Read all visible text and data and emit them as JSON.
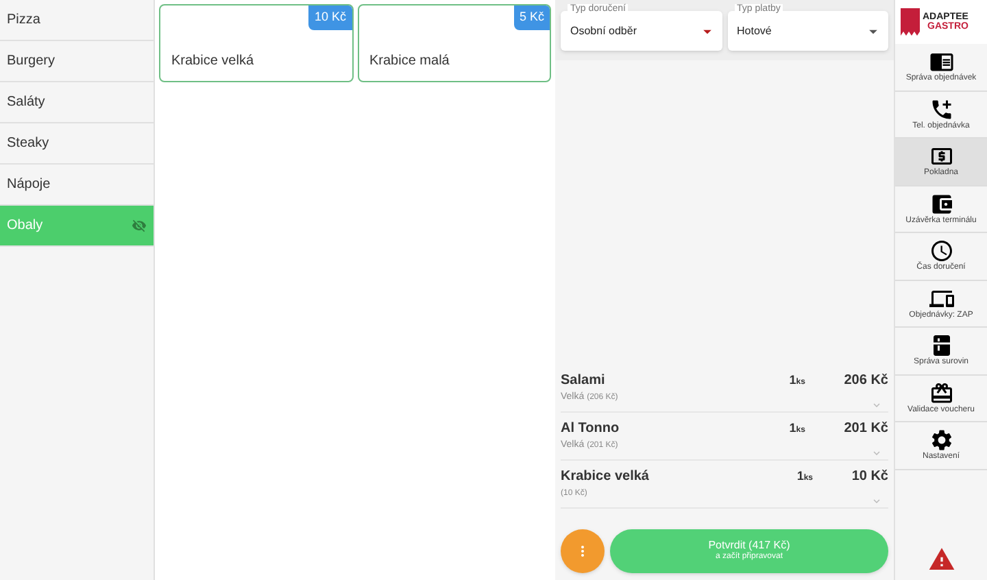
{
  "categories": [
    {
      "label": "Pizza",
      "selected": false,
      "hidden": false
    },
    {
      "label": "Burgery",
      "selected": false,
      "hidden": false
    },
    {
      "label": "Saláty",
      "selected": false,
      "hidden": false
    },
    {
      "label": "Steaky",
      "selected": false,
      "hidden": false
    },
    {
      "label": "Nápoje",
      "selected": false,
      "hidden": false
    },
    {
      "label": "Obaly",
      "selected": true,
      "hidden": true
    }
  ],
  "products": [
    {
      "name": "Krabice velká",
      "price": "10 Kč"
    },
    {
      "name": "Krabice malá",
      "price": "5 Kč"
    }
  ],
  "order": {
    "fields": [
      {
        "label": "Typ doručení",
        "value": "Osobní odběr",
        "color": "#b71c1c"
      },
      {
        "label": "Typ platby",
        "value": "Hotové",
        "color": "#555555"
      }
    ],
    "items": [
      {
        "name": "Salami",
        "detail": "Velká",
        "detail_price": "(206 Kč)",
        "quantity": "1",
        "unit": "ks",
        "price": "206 Kč"
      },
      {
        "name": "Al Tonno",
        "detail": "Velká",
        "detail_price": "(201 Kč)",
        "quantity": "1",
        "unit": "ks",
        "price": "201 Kč"
      },
      {
        "name": "Krabice velká",
        "detail_price": "(10 Kč)",
        "quantity": "1",
        "unit": "ks",
        "price": "10 Kč"
      }
    ],
    "confirm": {
      "label": "Potvrdit (417 Kč)",
      "sublabel": "a začít připravovat"
    }
  },
  "nav": {
    "logo": [
      "ADAPTEE",
      "GASTRO"
    ],
    "items": [
      {
        "label": "Správa objednávek",
        "selected": false
      },
      {
        "label": "Tel. objednávka",
        "selected": false
      },
      {
        "label": "Pokladna",
        "selected": true
      },
      {
        "label": "Uzávěrka terminálu",
        "selected": false
      },
      {
        "label": "Čas doručení",
        "selected": false
      },
      {
        "label": "Objednávky: ZAP",
        "selected": false
      },
      {
        "label": "Správa surovin",
        "selected": false
      },
      {
        "label": "Validace voucheru",
        "selected": false
      },
      {
        "label": "Nastavení",
        "selected": false
      }
    ]
  }
}
